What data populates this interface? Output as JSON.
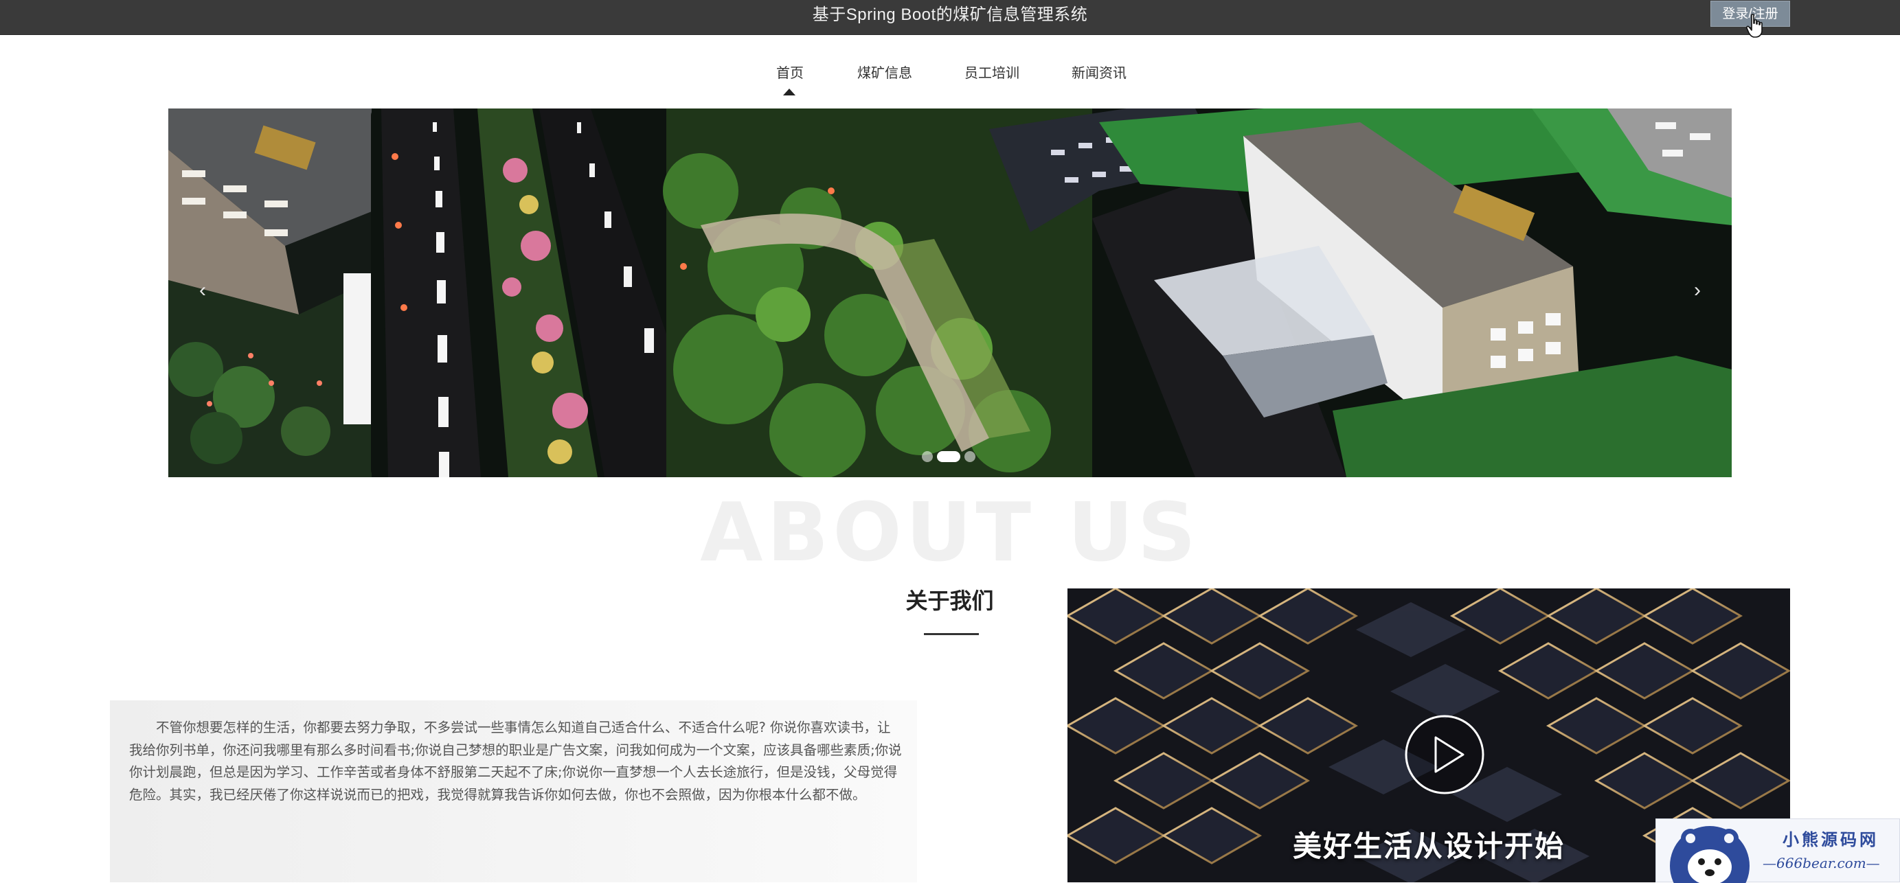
{
  "header": {
    "site_title": "基于Spring Boot的煤矿信息管理系统",
    "login_label": "登录/注册"
  },
  "nav": {
    "items": [
      {
        "label": "首页",
        "active": true
      },
      {
        "label": "煤矿信息",
        "active": false
      },
      {
        "label": "员工培训",
        "active": false
      },
      {
        "label": "新闻资讯",
        "active": false
      }
    ]
  },
  "carousel": {
    "slide_count": 3,
    "active_index": 1,
    "prev_icon": "chevron-left-icon",
    "next_icon": "chevron-right-icon"
  },
  "about": {
    "background_text": "ABOUT US",
    "title": "关于我们",
    "body": "不管你想要怎样的生活，你都要去努力争取，不多尝试一些事情怎么知道自己适合什么、不适合什么呢? 你说你喜欢读书，让我给你列书单，你还问我哪里有那么多时间看书;你说自己梦想的职业是广告文案，问我如何成为一个文案，应该具备哪些素质;你说你计划晨跑，但总是因为学习、工作辛苦或者身体不舒服第二天起不了床;你说你一直梦想一个人去长途旅行，但是没钱，父母觉得危险。其实，我已经厌倦了你这样说说而已的把戏，我觉得就算我告诉你如何去做，你也不会照做，因为你根本什么都不做。"
  },
  "video": {
    "caption": "美好生活从设计开始",
    "play_icon": "play-icon"
  },
  "watermark": {
    "line1": "小熊源码网",
    "line2": "—666bear.com—"
  },
  "colors": {
    "topbar": "#3a3a3a",
    "login_button": "#7d8b98",
    "watermark_blue": "#2e4b9c"
  }
}
